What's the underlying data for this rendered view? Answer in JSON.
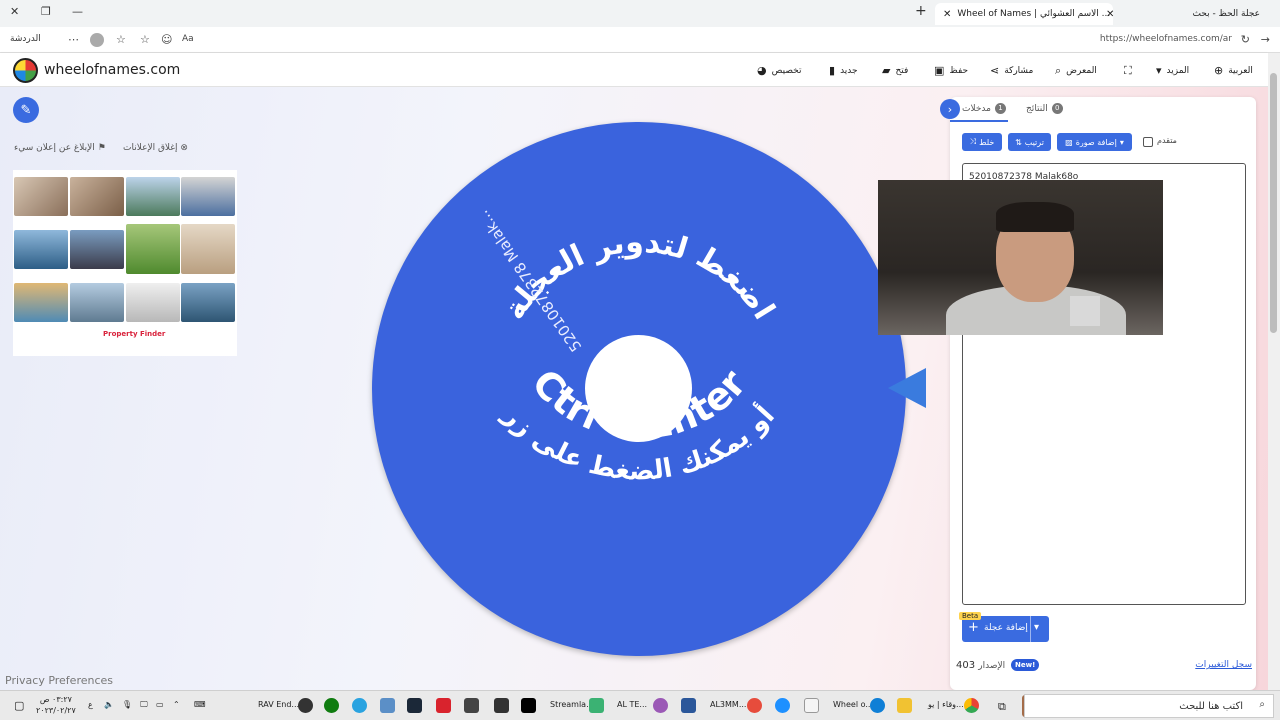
{
  "browser": {
    "tabs": [
      {
        "title": "عجلة الحظ - بحث",
        "active": false
      },
      {
        "title": "Wheel of Names | الاسم العشوائي ...",
        "active": true
      }
    ],
    "url": "https://wheelofnames.com/ar",
    "chat_label": "الدردشة"
  },
  "appbar": {
    "brand": "wheelofnames.com",
    "menu": {
      "customize": "تخصيص",
      "new": "جديد",
      "open": "فتح",
      "save": "حفظ",
      "share": "مشاركة",
      "gallery": "المعرض",
      "more": "المزيد",
      "language": "العربية"
    }
  },
  "ads": {
    "close_ads": "إغلاق الإعلانات",
    "report_ad": "الإبلاغ عن إعلان سيء",
    "brand": "Property Finder"
  },
  "wheel": {
    "line1": "اضغط لتدوير العجلة",
    "line2": "أو يمكنك الضغط على زر",
    "line3": "Ctrl + Enter",
    "entry": "52010872378 Malak...",
    "color": "#3a63dd"
  },
  "privacy": "Privacy Preferences",
  "panel": {
    "tab_entries": "مدخلات",
    "entries_count": "1",
    "tab_results": "النتائج",
    "results_count": "0",
    "shuffle": "خلط",
    "sort": "ترتيب",
    "add_image": "إضافة صورة",
    "advanced": "متقدم",
    "text": "52010872378 Malak68o",
    "add_wheel": "إضافة عجلة",
    "beta": "Beta",
    "version_label": "الإصدار",
    "version_number": "403",
    "new_badge": "New!",
    "changelog": "سجل التغييرات"
  },
  "taskbar": {
    "search": "اكتب هنا للبحث",
    "time": "٠٣:٢٧ ص",
    "date": "٢٠٢٣/٠٢/٢٧",
    "lang": "ع",
    "items": [
      "RAV End...",
      "Streamla...",
      "AL TE...",
      "AL3MM...",
      "Wheel o...",
      "وقاء | يو..."
    ]
  }
}
